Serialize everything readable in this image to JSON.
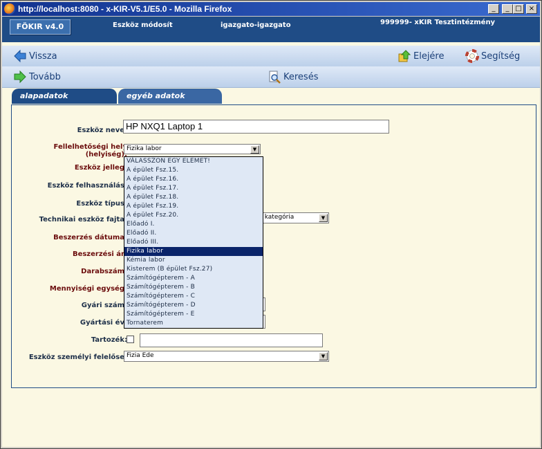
{
  "window": {
    "title": "http://localhost:8080 - x-KIR-V5.1/E5.0 - Mozilla Firefox",
    "btn_min": "_",
    "btn_max": "□",
    "btn_close": "×"
  },
  "header": {
    "logo": "FÖKIR v4.0",
    "page": "Eszköz módosít",
    "user": "igazgato-igazgato",
    "institution": "999999- xKIR Tesztintézmény"
  },
  "nav": {
    "back": "Vissza",
    "top": "Elejére",
    "help": "Segítség",
    "next": "Tovább",
    "search": "Keresés"
  },
  "tabs": [
    "alapadatok",
    "egyéb adatok"
  ],
  "form": {
    "labels": {
      "name": "Eszköz neve:",
      "location": "Fellelhetőségi hely\n(helyiség):",
      "jelleg": "Eszköz jelleg:",
      "felhasznalas": "Eszköz felhasználás:",
      "tipus": "Eszköz típus:",
      "fajta": "Technikai eszköz fajta:",
      "datum": "Beszerzés dátuma:",
      "ar": "Beszerzési ár:",
      "darab": "Darabszám:",
      "egyseg": "Mennyiségi egység:",
      "gyari": "Gyári szám:",
      "ev": "Gyártási év:",
      "tartozek": "Tartozék:",
      "felelos": "Eszköz személyi felelőse:"
    },
    "name_value": "HP NXQ1 Laptop 1",
    "location_value": "Fizika labor",
    "fajta_value": ". kategória",
    "felelos_value": "Fizia Ede",
    "location_options": [
      "VÁLASSZON EGY ELEMET!",
      "A épület Fsz.15.",
      "A épület Fsz.16.",
      "A épület Fsz.17.",
      "A épület Fsz.18.",
      "A épület Fsz.19.",
      "A épület Fsz.20.",
      "Előadó I.",
      "Előadó II.",
      "Előadó III.",
      "Fizika labor",
      "Kémia labor",
      "Kisterem (B épület Fsz.27)",
      "Számítógépterem - A",
      "Számítógépterem - B",
      "Számítógépterem - C",
      "Számítógépterem - D",
      "Számítógépterem - E",
      "Tornaterem"
    ],
    "selected_index": 10
  },
  "colors": {
    "header_bg": "#1f4c86",
    "tab_active": "#1f4c86",
    "tab_inactive": "#3a67a3",
    "page_bg": "#fbf8e3",
    "selected_option": "#0a246a"
  }
}
